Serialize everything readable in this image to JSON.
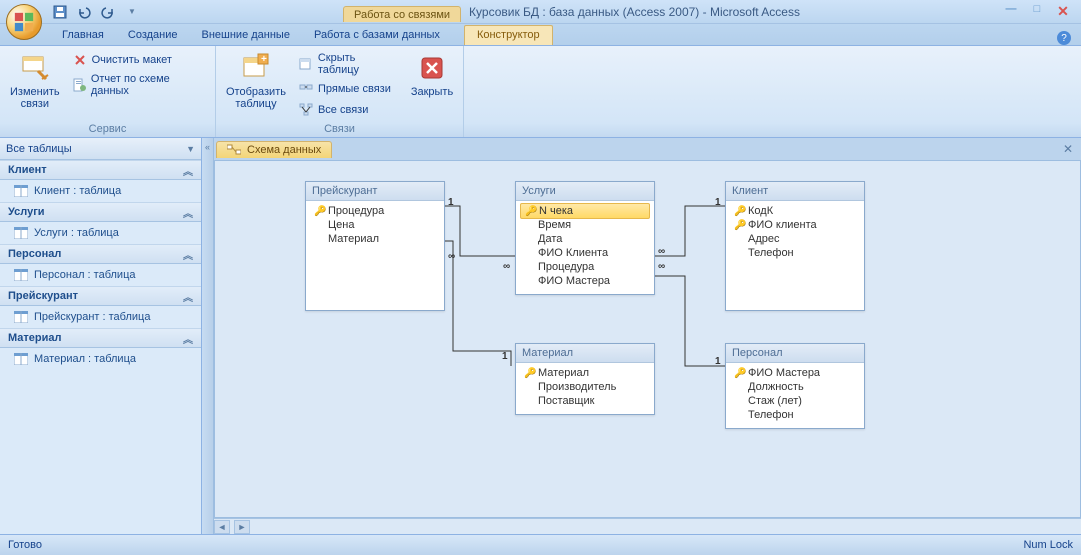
{
  "titlebar": {
    "context_label": "Работа со связями",
    "title": "Курсовик БД : база данных (Access 2007) - Microsoft Access"
  },
  "ribbon_tabs": {
    "home": "Главная",
    "create": "Создание",
    "external": "Внешние данные",
    "dbtools": "Работа с базами данных",
    "design": "Конструктор"
  },
  "ribbon": {
    "group_service": "Сервис",
    "group_links": "Связи",
    "edit_links": "Изменить связи",
    "clear_layout": "Очистить макет",
    "schema_report": "Отчет по схеме данных",
    "show_table": "Отобразить таблицу",
    "hide_table": "Скрыть таблицу",
    "direct_links": "Прямые связи",
    "all_links": "Все связи",
    "close": "Закрыть"
  },
  "nav": {
    "header": "Все таблицы",
    "groups": [
      {
        "name": "Клиент",
        "items": [
          "Клиент : таблица"
        ]
      },
      {
        "name": "Услуги",
        "items": [
          "Услуги : таблица"
        ]
      },
      {
        "name": "Персонал",
        "items": [
          "Персонал : таблица"
        ]
      },
      {
        "name": "Прейскурант",
        "items": [
          "Прейскурант : таблица"
        ]
      },
      {
        "name": "Материал",
        "items": [
          "Материал : таблица"
        ]
      }
    ]
  },
  "doc_tab": "Схема данных",
  "tables": {
    "preis": {
      "title": "Прейскурант",
      "fields": [
        "Процедура",
        "Цена",
        "Материал"
      ]
    },
    "uslugi": {
      "title": "Услуги",
      "fields": [
        "N чека",
        "Время",
        "Дата",
        "ФИО Клиента",
        "Процедура",
        "ФИО Мастера"
      ]
    },
    "klient": {
      "title": "Клиент",
      "fields": [
        "КодК",
        "ФИО клиента",
        "Адрес",
        "Телефон"
      ]
    },
    "material": {
      "title": "Материал",
      "fields": [
        "Материал",
        "Производитель",
        "Поставщик"
      ]
    },
    "personal": {
      "title": "Персонал",
      "fields": [
        "ФИО Мастера",
        "Должность",
        "Стаж (лет)",
        "Телефон"
      ]
    }
  },
  "status": {
    "ready": "Готово",
    "numlock": "Num Lock"
  }
}
